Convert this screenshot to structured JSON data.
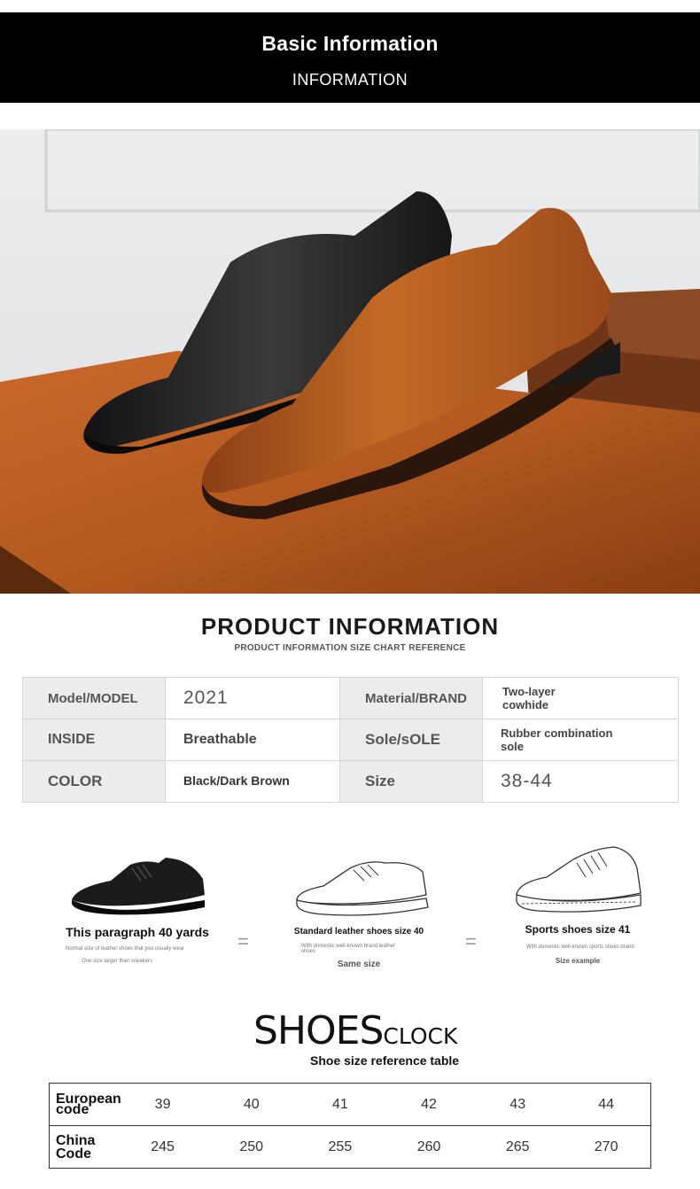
{
  "banner": {
    "title": "Basic Information",
    "subtitle": "INFORMATION"
  },
  "product_info": {
    "title": "PRODUCT INFORMATION",
    "subtitle": "PRODUCT INFORMATION SIZE CHART REFERENCE",
    "rows": [
      {
        "label1": "Model/MODEL",
        "value1": "2021",
        "label2": "Material/BRAND",
        "value2_line1": "Two-layer",
        "value2_line2": "cowhide"
      },
      {
        "label1": "INSIDE",
        "value1": "Breathable",
        "label2": "Sole/sOLE",
        "value2_line1": "Rubber combination",
        "value2_line2": "sole"
      },
      {
        "label1": "COLOR",
        "value1": "Black/Dark Brown",
        "label2": "Size",
        "value2": "38-44"
      }
    ]
  },
  "comparison": {
    "items": [
      {
        "title": "This paragraph 40 yards",
        "fine1": "Normal size of leather shoes that you usually wear",
        "fine2": "One size larger than sneakers"
      },
      {
        "title": "Standard leather shoes size 40",
        "fine1": "With domestic well-known brand leather shoes",
        "fine2": "Same size"
      },
      {
        "title": "Sports shoes size 41",
        "fine1": "With domestic well-known sports shoes brand",
        "fine2": "Size example"
      }
    ],
    "equals": "="
  },
  "size_chart": {
    "title_big": "SHOES",
    "title_small": "CLOCK",
    "subtitle": "Shoe size reference table",
    "rows": [
      {
        "label_line1": "European",
        "label_line2": "code",
        "values": [
          "39",
          "40",
          "41",
          "42",
          "43",
          "44"
        ]
      },
      {
        "label_line1": "China",
        "label_line2": "Code",
        "values": [
          "245",
          "250",
          "255",
          "260",
          "265",
          "270"
        ]
      }
    ]
  },
  "colors": {
    "banner_bg": "#000000",
    "label_cell_bg": "#ececec",
    "border": "#d6d6d6"
  }
}
